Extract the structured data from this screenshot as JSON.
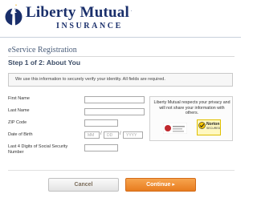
{
  "brand": {
    "name": "Liberty Mutual",
    "trademark": ".",
    "subtitle": "INSURANCE"
  },
  "page": {
    "title": "eService Registration",
    "step": "Step 1 of 2: About You"
  },
  "info": {
    "text": "We use this information to securely verify your identity.  All fields are required."
  },
  "form": {
    "first_name_label": "First Name",
    "last_name_label": "Last Name",
    "zip_label": "ZIP Code",
    "dob_label": "Date of Birth",
    "ssn_label": "Last 4 Digits of Social Security Number",
    "dob_mm_placeholder": "MM",
    "dob_dd_placeholder": "DD",
    "dob_yyyy_placeholder": "YYYY",
    "dob_separator": "/"
  },
  "privacy": {
    "text": "Liberty Mutual respects your privacy and will not share your information with others.",
    "seal_norton": "Norton",
    "seal_norton_sub": "SECURED"
  },
  "buttons": {
    "cancel": "Cancel",
    "continue": "Continue ▸"
  },
  "colors": {
    "brand_navy": "#1a2f6b",
    "continue_orange": "#e77c1f",
    "heading_slate": "#3b4c66"
  }
}
